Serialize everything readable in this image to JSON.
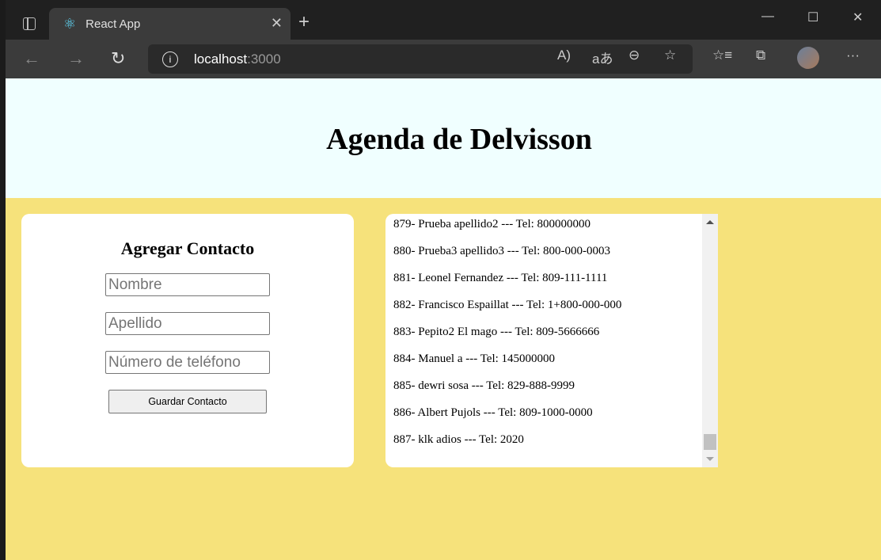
{
  "browser": {
    "tab_title": "React App",
    "address_host": "localhost",
    "address_port": ":3000"
  },
  "header": {
    "title": "Agenda de Delvisson"
  },
  "form": {
    "title": "Agregar Contacto",
    "nombre_placeholder": "Nombre",
    "apellido_placeholder": "Apellido",
    "telefono_placeholder": "Número de teléfono",
    "save_label": "Guardar Contacto"
  },
  "contacts": [
    "879- Prueba apellido2 --- Tel: 800000000",
    "880- Prueba3 apellido3 --- Tel: 800-000-0003",
    "881- Leonel Fernandez --- Tel: 809-111-1111",
    "882- Francisco Espaillat --- Tel: 1+800-000-000",
    "883- Pepito2 El mago --- Tel: 809-5666666",
    "884- Manuel a --- Tel: 145000000",
    "885- dewri sosa --- Tel: 829-888-9999",
    "886- Albert Pujols --- Tel: 809-1000-0000",
    "887- klk adios --- Tel: 2020"
  ],
  "colors": {
    "header_bg": "#f0ffff",
    "page_bg": "#f6e27b"
  }
}
